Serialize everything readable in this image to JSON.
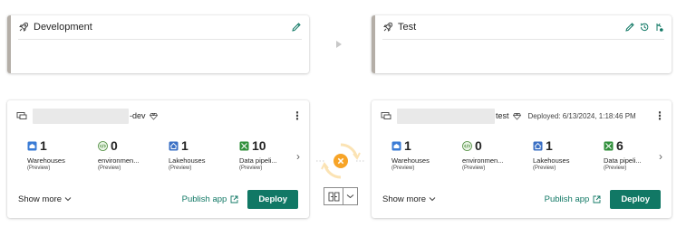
{
  "stages": {
    "dev": {
      "title": "Development"
    },
    "test": {
      "title": "Test"
    }
  },
  "workspaces": {
    "dev": {
      "name_suffix": "-dev",
      "items": [
        {
          "count": "1",
          "name": "Warehouses",
          "preview": "(Preview)",
          "icon": "warehouse-icon"
        },
        {
          "count": "0",
          "name": "environmen...",
          "preview": "(Preview)",
          "icon": "environment-icon"
        },
        {
          "count": "1",
          "name": "Lakehouses",
          "preview": "(Preview)",
          "icon": "lakehouse-icon"
        },
        {
          "count": "10",
          "name": "Data pipeli...",
          "preview": "(Preview)",
          "icon": "pipeline-icon"
        }
      ],
      "show_more": "Show more",
      "publish": "Publish app",
      "deploy": "Deploy"
    },
    "test": {
      "name_suffix": "test",
      "deployed": "Deployed: 6/13/2024, 1:18:46 PM",
      "items": [
        {
          "count": "1",
          "name": "Warehouses",
          "preview": "(Preview)",
          "icon": "warehouse-icon"
        },
        {
          "count": "0",
          "name": "environmen...",
          "preview": "(Preview)",
          "icon": "environment-icon"
        },
        {
          "count": "1",
          "name": "Lakehouses",
          "preview": "(Preview)",
          "icon": "lakehouse-icon"
        },
        {
          "count": "6",
          "name": "Data pipeli...",
          "preview": "(Preview)",
          "icon": "pipeline-icon"
        }
      ],
      "show_more": "Show more",
      "publish": "Publish app",
      "deploy": "Deploy"
    }
  },
  "colors": {
    "accent": "#117865",
    "stage_bar": "#b4aea7",
    "compare_orange": "#f7a427"
  }
}
